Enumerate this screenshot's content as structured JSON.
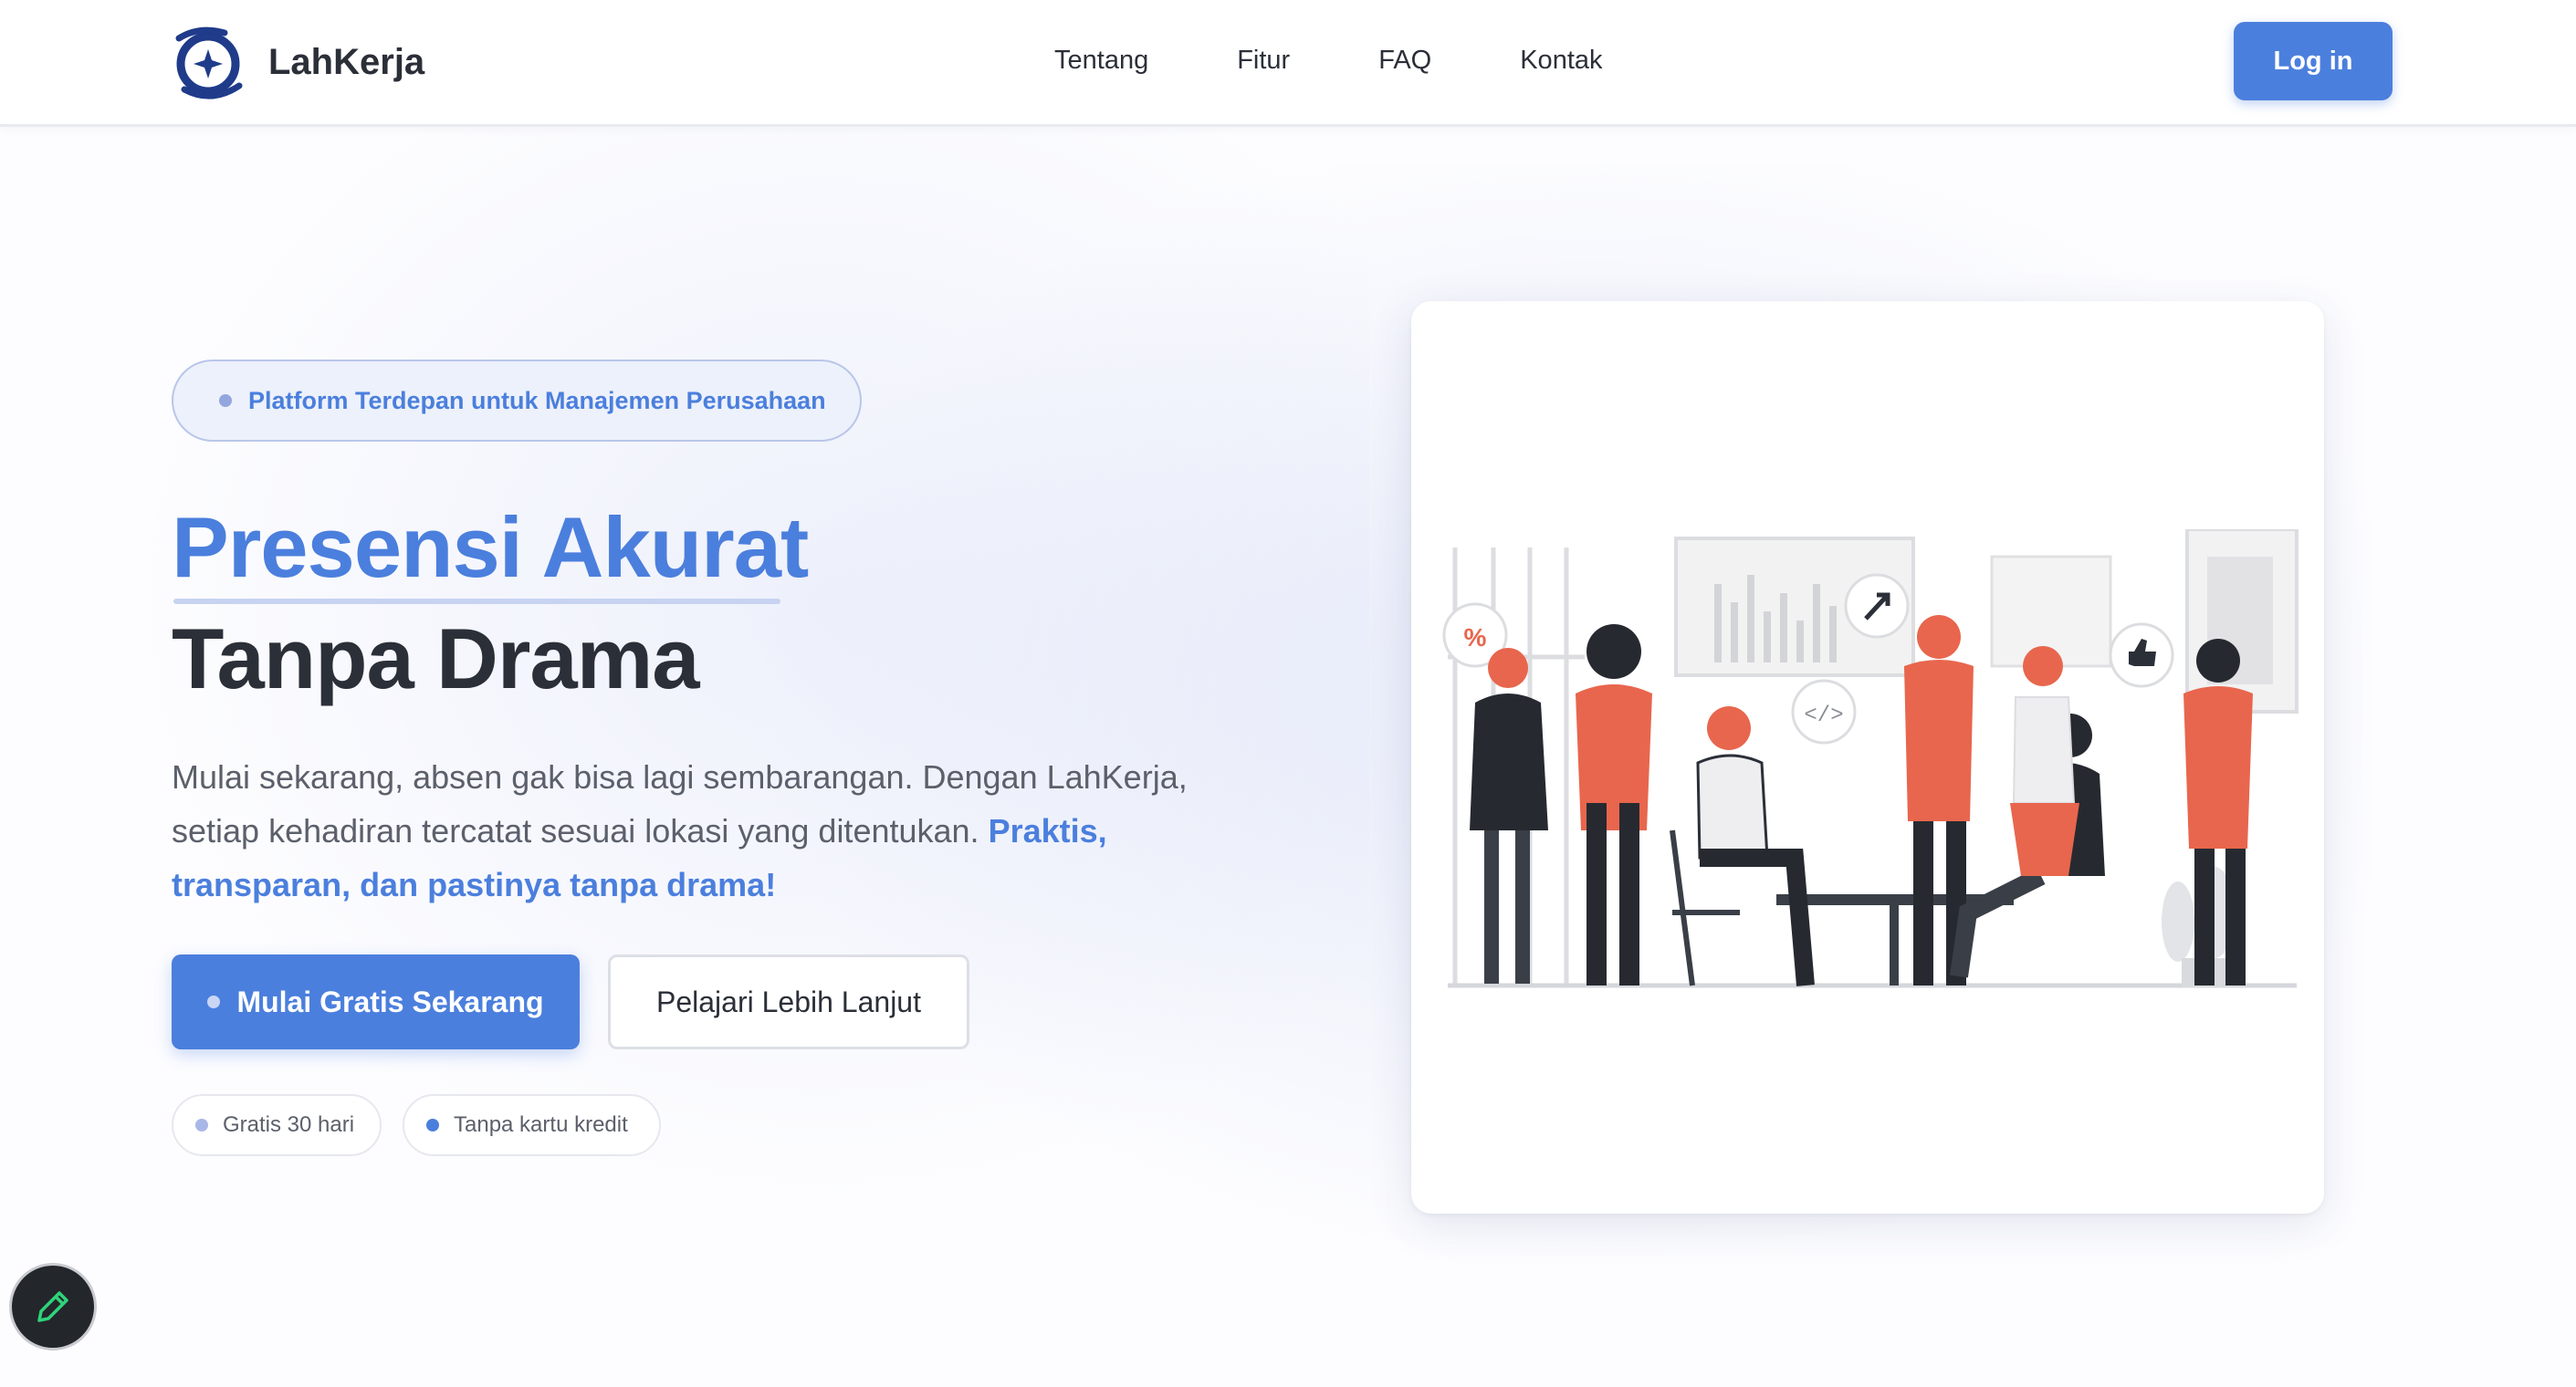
{
  "nav": {
    "brand": "LahKerja",
    "links": [
      "Tentang",
      "Fitur",
      "FAQ",
      "Kontak"
    ],
    "login_label": "Log in"
  },
  "hero": {
    "badge": "Platform Terdepan untuk Manajemen Perusahaan",
    "headline_accent": "Presensi Akurat",
    "headline_main": "Tanpa Drama",
    "description": "Mulai sekarang, absen gak bisa lagi sembarangan. Dengan LahKerja, setiap kehadiran tercatat sesuai lokasi yang ditentukan.",
    "description_highlight": "Praktis, transparan, dan pastinya tanpa drama!",
    "cta_primary": "Mulai Gratis Sekarang",
    "cta_secondary": "Pelajari Lebih Lanjut",
    "perks": [
      "Gratis 30 hari",
      "Tanpa kartu kredit"
    ]
  },
  "illustration": {
    "bubble_symbols": [
      "%",
      "</>"
    ],
    "icons": [
      "percent-bubble-icon",
      "arrow-bubble-icon",
      "code-bubble-icon",
      "thumbs-up-bubble-icon"
    ]
  },
  "colors": {
    "accent": "#4b7fdd",
    "text_dark": "#2b2f38",
    "illustration_orange": "#e8664d",
    "illustration_dark": "#262a30",
    "fab_pencil": "#2fd37a"
  },
  "fab": {
    "icon": "pencil-icon"
  }
}
